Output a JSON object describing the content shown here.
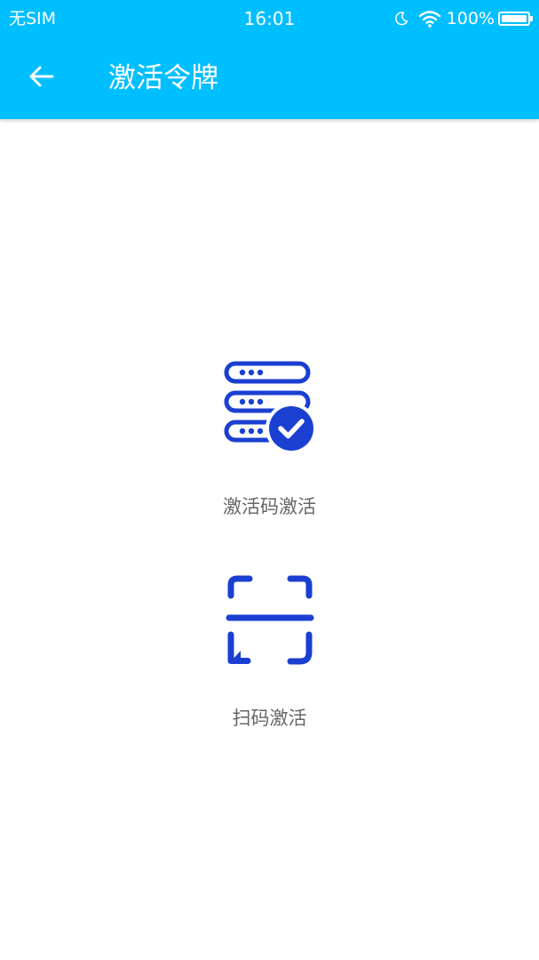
{
  "status_bar": {
    "carrier": "无SIM",
    "time": "16:01",
    "battery_percent": "100%",
    "battery_level": 1.0,
    "icons": [
      "moon-icon",
      "wifi-icon",
      "battery-icon"
    ]
  },
  "toolbar": {
    "back_icon": "arrow-left-icon",
    "title": "激活令牌"
  },
  "options": [
    {
      "icon": "server-check-icon",
      "label": "激活码激活"
    },
    {
      "icon": "scan-frame-icon",
      "label": "扫码激活"
    }
  ],
  "colors": {
    "header_bg": "#00BFFF",
    "icon_blue": "#1A3FD1",
    "label_gray": "#666666",
    "background": "#FFFFFF"
  }
}
